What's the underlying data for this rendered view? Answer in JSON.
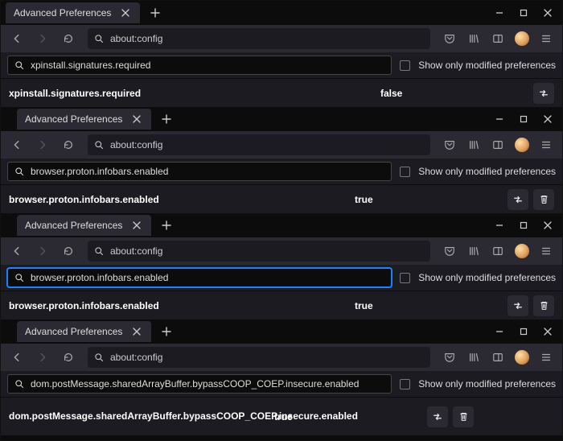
{
  "common": {
    "tab_title": "Advanced Preferences",
    "url": "about:config",
    "checkbox_label": "Show only modified preferences"
  },
  "panels": [
    {
      "indent": false,
      "search_value": "xpinstall.signatures.required",
      "search_focused": false,
      "pref_name": "xpinstall.signatures.required",
      "pref_value": "false",
      "has_reset": false,
      "tall_row": false
    },
    {
      "indent": true,
      "search_value": "browser.proton.infobars.enabled",
      "search_focused": false,
      "pref_name": "browser.proton.infobars.enabled",
      "pref_value": "true",
      "has_reset": true,
      "tall_row": false
    },
    {
      "indent": true,
      "search_value": "browser.proton.infobars.enabled",
      "search_focused": true,
      "pref_name": "browser.proton.infobars.enabled",
      "pref_value": "true",
      "has_reset": true,
      "tall_row": false
    },
    {
      "indent": true,
      "search_value": "dom.postMessage.sharedArrayBuffer.bypassCOOP_COEP.insecure.enabled",
      "search_focused": false,
      "pref_name": "dom.postMessage.sharedArrayBuffer.bypassCOOP_COEP.insecure.enabled",
      "pref_value": "true",
      "has_reset": true,
      "tall_row": true
    }
  ]
}
